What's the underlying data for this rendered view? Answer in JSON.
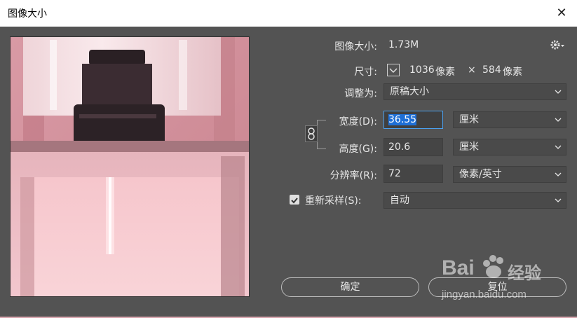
{
  "window": {
    "title": "图像大小",
    "close_glyph": "✕"
  },
  "image_size": {
    "label": "图像大小:",
    "value": "1.73M"
  },
  "dimensions": {
    "label": "尺寸:",
    "width": "1036",
    "width_unit": "像素",
    "times": "×",
    "height": "584",
    "height_unit": "像素"
  },
  "fit_to": {
    "label": "调整为:",
    "value": "原稿大小"
  },
  "width": {
    "label": "宽度(D):",
    "value": "36.55",
    "unit": "厘米"
  },
  "height": {
    "label": "高度(G):",
    "value": "20.6",
    "unit": "厘米"
  },
  "resolution": {
    "label": "分辨率(R):",
    "value": "72",
    "unit": "像素/英寸"
  },
  "resample": {
    "label": "重新采样(S):",
    "checked": true,
    "value": "自动"
  },
  "buttons": {
    "ok": "确定",
    "reset": "复位"
  },
  "watermark": {
    "brand_a": "Bai",
    "brand_b": "经验",
    "url": "jingyan.baidu.com"
  },
  "colors": {
    "accent": "#4aa0ee",
    "dialog_bg": "#535353",
    "field_bg": "#454545"
  }
}
